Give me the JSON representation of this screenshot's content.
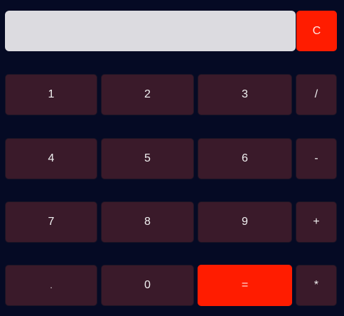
{
  "display": {
    "value": "",
    "placeholder": ""
  },
  "buttons": {
    "clear": "C",
    "one": "1",
    "two": "2",
    "three": "3",
    "divide": "/",
    "four": "4",
    "five": "5",
    "six": "6",
    "minus": "-",
    "seven": "7",
    "eight": "8",
    "nine": "9",
    "plus": "+",
    "decimal": ".",
    "zero": "0",
    "equals": "=",
    "multiply": "*"
  },
  "colors": {
    "background": "#050a24",
    "display": "#dcdbe0",
    "button": "#3a1a2a",
    "accent": "#ff1c00",
    "text": "#f1f1f1"
  }
}
